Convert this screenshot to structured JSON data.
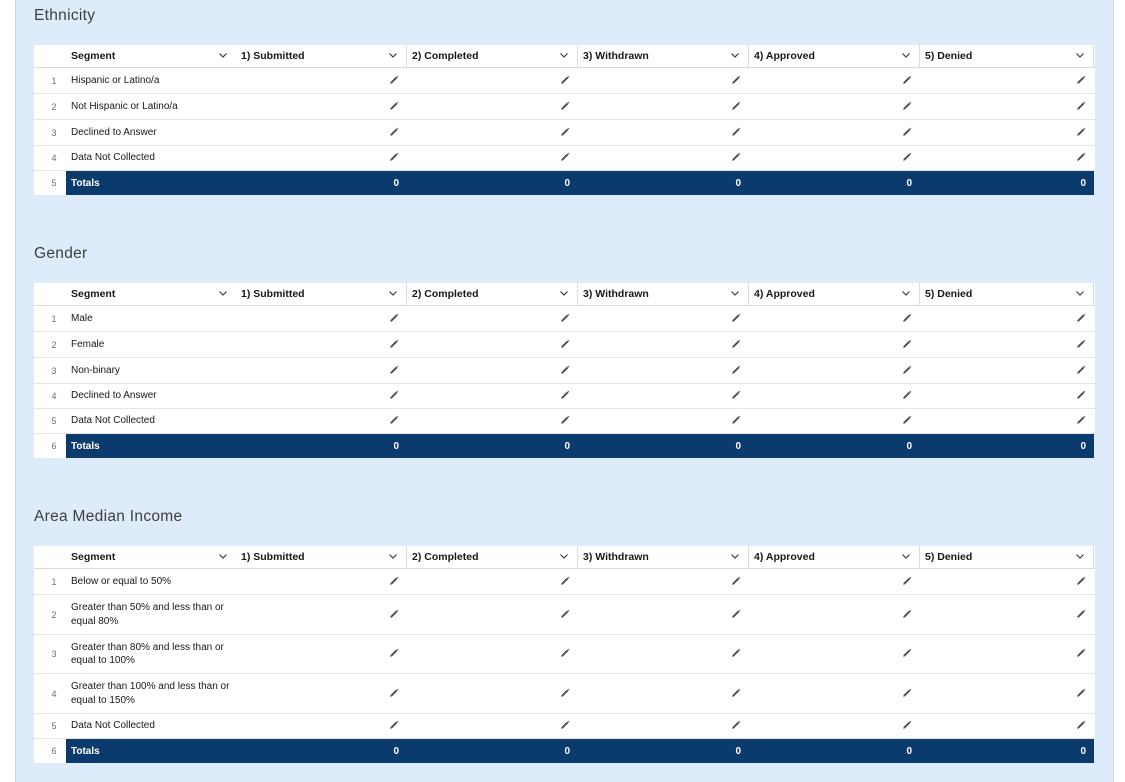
{
  "columns": [
    "Segment",
    "1) Submitted",
    "2) Completed",
    "3) Withdrawn",
    "4) Approved",
    "5) Denied"
  ],
  "sections": [
    {
      "title": "Ethnicity",
      "rows": [
        {
          "num": "1",
          "label": "Hispanic or Latino/a"
        },
        {
          "num": "2",
          "label": "Not Hispanic or Latino/a"
        },
        {
          "num": "3",
          "label": "Declined to Answer"
        },
        {
          "num": "4",
          "label": "Data Not Collected"
        }
      ],
      "totals": {
        "num": "5",
        "label": "Totals",
        "values": [
          "0",
          "0",
          "0",
          "0",
          "0"
        ]
      }
    },
    {
      "title": "Gender",
      "rows": [
        {
          "num": "1",
          "label": "Male"
        },
        {
          "num": "2",
          "label": "Female"
        },
        {
          "num": "3",
          "label": "Non-binary"
        },
        {
          "num": "4",
          "label": "Declined to Answer"
        },
        {
          "num": "5",
          "label": "Data Not Collected"
        }
      ],
      "totals": {
        "num": "6",
        "label": "Totals",
        "values": [
          "0",
          "0",
          "0",
          "0",
          "0"
        ]
      }
    },
    {
      "title": "Area Median Income",
      "rows": [
        {
          "num": "1",
          "label": "Below or equal to 50%"
        },
        {
          "num": "2",
          "label": "Greater than 50% and less than or equal 80%"
        },
        {
          "num": "3",
          "label": "Greater than 80% and less than or equal to 100%"
        },
        {
          "num": "4",
          "label": "Greater than 100% and less than or equal to 150%"
        },
        {
          "num": "5",
          "label": "Data Not Collected"
        }
      ],
      "totals": {
        "num": "6",
        "label": "Totals",
        "values": [
          "0",
          "0",
          "0",
          "0",
          "0"
        ]
      }
    }
  ],
  "icons": {
    "edit": "pencil-icon",
    "sort": "chevron-down-icon"
  },
  "colors": {
    "panel_bg": "#deebfb",
    "totals_bg": "#0b3a6c"
  }
}
